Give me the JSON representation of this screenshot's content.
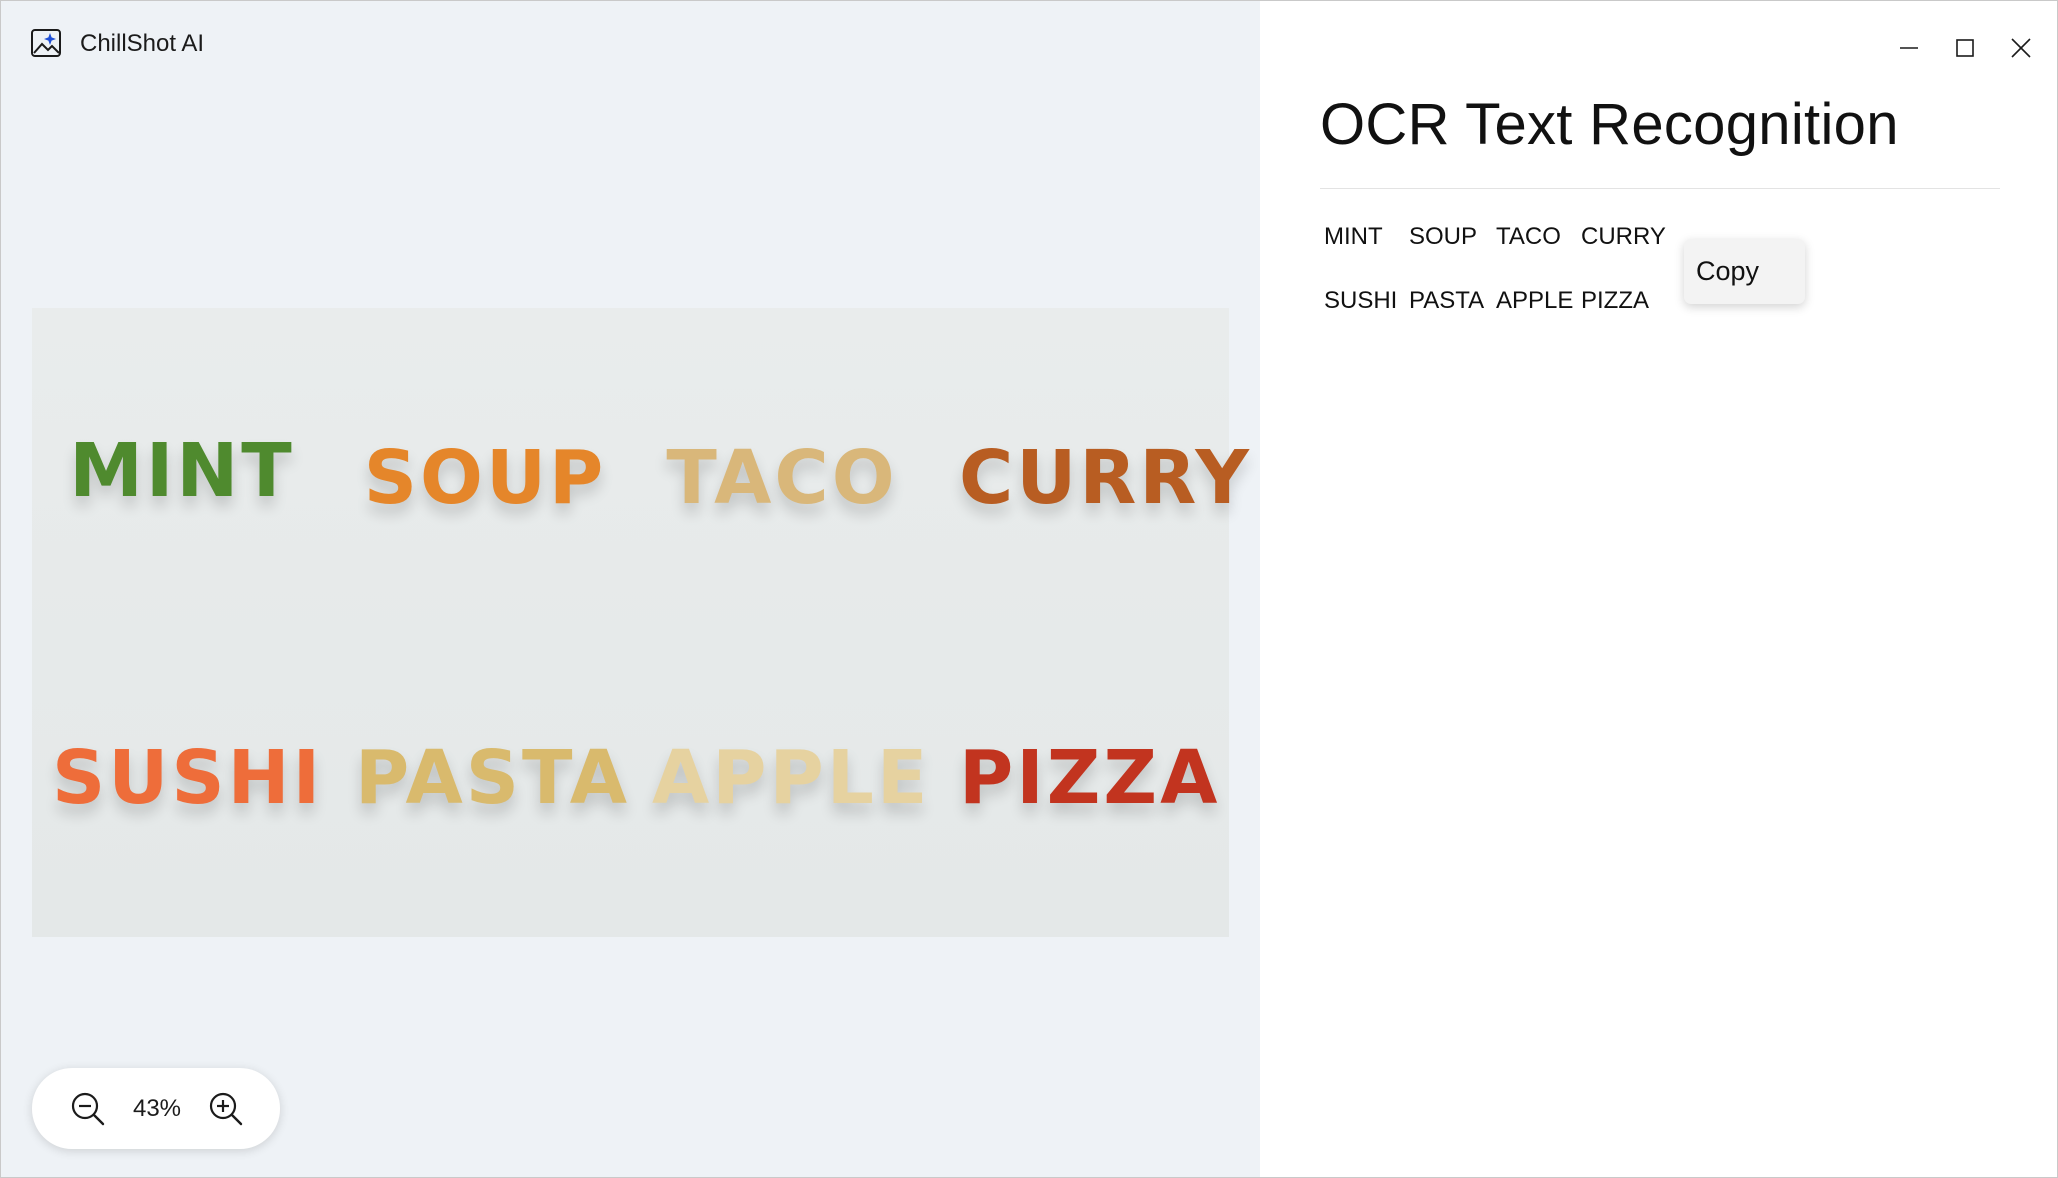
{
  "app": {
    "name": "ChillShot AI"
  },
  "preview": {
    "photo_words": [
      {
        "text": "MINT",
        "color": "#4f8a2e"
      },
      {
        "text": "SOUP",
        "color": "#e5862a"
      },
      {
        "text": "TACO",
        "color": "#d9b77a"
      },
      {
        "text": "CURRY",
        "color": "#b85d22"
      },
      {
        "text": "SUSHI",
        "color": "#ee6d3a"
      },
      {
        "text": "PASTA",
        "color": "#d9ba6d"
      },
      {
        "text": "APPLE",
        "color": "#e6d2a0"
      },
      {
        "text": "PIZZA",
        "color": "#c2341f"
      }
    ],
    "zoom": {
      "value": "43%",
      "zoom_out_icon": "zoom-out-icon",
      "zoom_in_icon": "zoom-in-icon"
    }
  },
  "window_controls": {
    "minimize": "minimize-icon",
    "maximize": "maximize-icon",
    "close": "close-icon"
  },
  "panel": {
    "title": "OCR Text Recognition",
    "words": [
      "MINT",
      "SOUP",
      "TACO",
      "CURRY",
      "SUSHI",
      "PASTA",
      "APPLE",
      "PIZZA"
    ],
    "context_menu": {
      "copy_label": "Copy"
    }
  },
  "colors": {
    "preview_bg": "#eef2f6",
    "panel_bg": "#ffffff",
    "accent": "#1f4fd6"
  }
}
